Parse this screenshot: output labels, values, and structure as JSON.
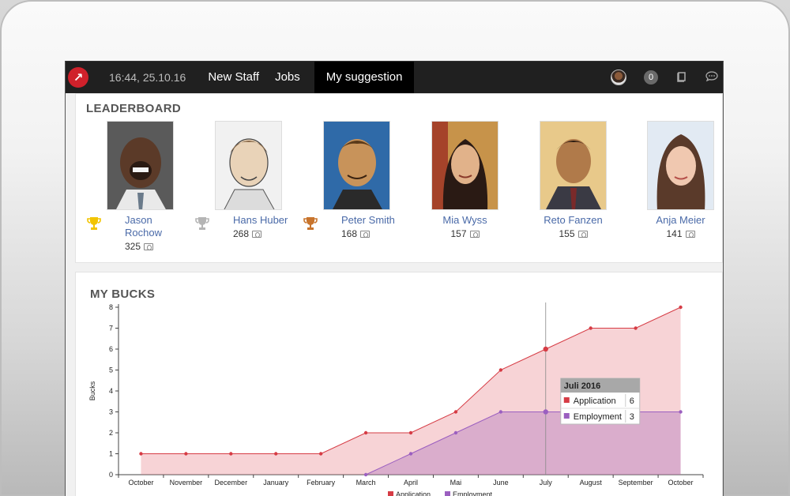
{
  "topbar": {
    "logo_glyph": "↗",
    "clock": "16:44, 25.10.16",
    "nav": [
      "New Staff",
      "Jobs",
      "My suggestion"
    ],
    "badge_count": "0"
  },
  "leaderboard": {
    "title": "LEADERBOARD",
    "people": [
      {
        "name": "Jason Rochow",
        "score": "325",
        "trophy": "gold"
      },
      {
        "name": "Hans Huber",
        "score": "268",
        "trophy": "silver"
      },
      {
        "name": "Peter Smith",
        "score": "168",
        "trophy": "bronze"
      },
      {
        "name": "Mia Wyss",
        "score": "157",
        "trophy": ""
      },
      {
        "name": "Reto Fanzen",
        "score": "155",
        "trophy": ""
      },
      {
        "name": "Anja Meier",
        "score": "141",
        "trophy": ""
      }
    ],
    "trophy_colors": {
      "gold": "#f2c400",
      "silver": "#b5b5b5",
      "bronze": "#c8742c"
    }
  },
  "my_bucks": {
    "title": "MY BUCKS"
  },
  "chart_data": {
    "type": "area",
    "categories": [
      "October",
      "November",
      "December",
      "January",
      "February",
      "March",
      "April",
      "Mai",
      "June",
      "July",
      "August",
      "September",
      "October"
    ],
    "series": [
      {
        "name": "Application",
        "color": "#d63c45",
        "values": [
          1,
          1,
          1,
          1,
          1,
          2,
          2,
          3,
          5,
          6,
          7,
          7,
          8
        ]
      },
      {
        "name": "Employment",
        "color": "#9b5fc0",
        "values": [
          null,
          null,
          null,
          null,
          null,
          0,
          1,
          2,
          3,
          3,
          3,
          3,
          3
        ]
      }
    ],
    "ylabel": "Bucks",
    "ylim": [
      0,
      8
    ],
    "yticks": [
      0,
      1,
      2,
      3,
      4,
      5,
      6,
      7,
      8
    ],
    "legend": "bottom-center",
    "tooltip": {
      "title": "Juli 2016",
      "rows": [
        {
          "label": "Application",
          "value": "6"
        },
        {
          "label": "Employment",
          "value": "3"
        }
      ],
      "category_index": 9
    }
  }
}
